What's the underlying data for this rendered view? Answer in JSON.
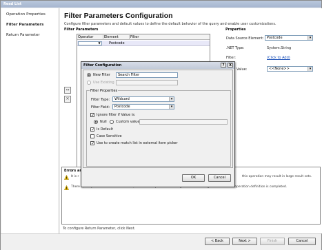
{
  "window": {
    "title": "Read List"
  },
  "sidebar": {
    "items": [
      {
        "label": "Operation Properties"
      },
      {
        "label": "Filter Parameters"
      },
      {
        "label": "Return Parameter"
      }
    ]
  },
  "page": {
    "title": "Filter Parameters Configuration",
    "description": "Configure filter parameters and default values to define the default behavior of the query and enable user customizations."
  },
  "filter_parameters": {
    "label": "Filter Parameters",
    "columns": [
      "Operator",
      "Element",
      "Filter"
    ],
    "rows": [
      {
        "operator": "",
        "element": "Postcode",
        "filter": ""
      }
    ]
  },
  "properties": {
    "label": "Properties",
    "data_source_element_label": "Data Source Element:",
    "data_source_element_value": "Postcode",
    "net_type_label": ".NET Type:",
    "net_type_value": "System.String",
    "filter_label": "Filter:",
    "filter_link": "(Click to Add)",
    "value_label": "Value:",
    "value_value": "<<None>>"
  },
  "errors": {
    "title": "Errors and",
    "rows": [
      {
        "text_left": "It is r",
        "text_right": "this operation may result in large result sets."
      },
      {
        "text": "There is/no operations with return value, so all return parameter configurations will be ignored when the operation definition is completed."
      }
    ]
  },
  "footer_note": "To configure Return Parameter, click Next.",
  "buttons": {
    "back": "< Back",
    "next": "Next >",
    "finish": "Finish",
    "cancel": "Cancel"
  },
  "dialog": {
    "title": "Filter Configuration",
    "help_btn": "?",
    "close_btn": "X",
    "new_filter_label": "New Filter",
    "new_filter_value": "Search Filter",
    "use_existing_label": "Use Existing",
    "group_title": "Filter Properties",
    "filter_type_label": "Filter Type:",
    "filter_type_value": "Wildcard",
    "filter_field_label": "Filter Field:",
    "filter_field_value": "Postcode",
    "ignore_label": "Ignore filter if Value is:",
    "null_label": "Null",
    "custom_value_label": "Custom value:",
    "is_default_label": "Is Default",
    "case_sensitive_label": "Case Sensitive",
    "picker_label": "Use to create match list in external item picker",
    "ok": "OK",
    "cancel": "Cancel"
  }
}
